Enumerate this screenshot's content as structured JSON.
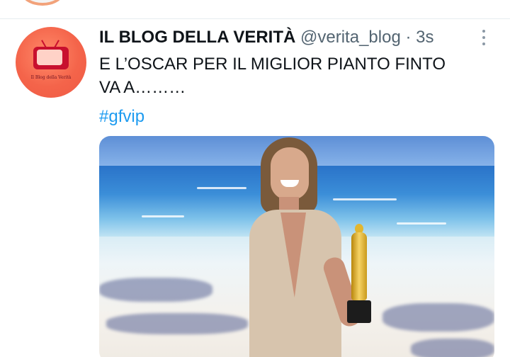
{
  "tweet": {
    "display_name": "IL BLOG DELLA VERITÀ",
    "handle": "@verita_blog",
    "separator": "·",
    "time": "3s",
    "text": "E L’OSCAR PER IL MIGLIOR PIANTO FINTO\nVA A………",
    "hashtag": "#gfvip",
    "avatar_label": "Il Blog della Verità"
  },
  "icons": {
    "more": "more-vertical-icon",
    "avatar": "tv-logo-icon"
  },
  "colors": {
    "link": "#1d9bf0",
    "secondary_text": "#536471",
    "avatar_bg": "#f4644a"
  }
}
